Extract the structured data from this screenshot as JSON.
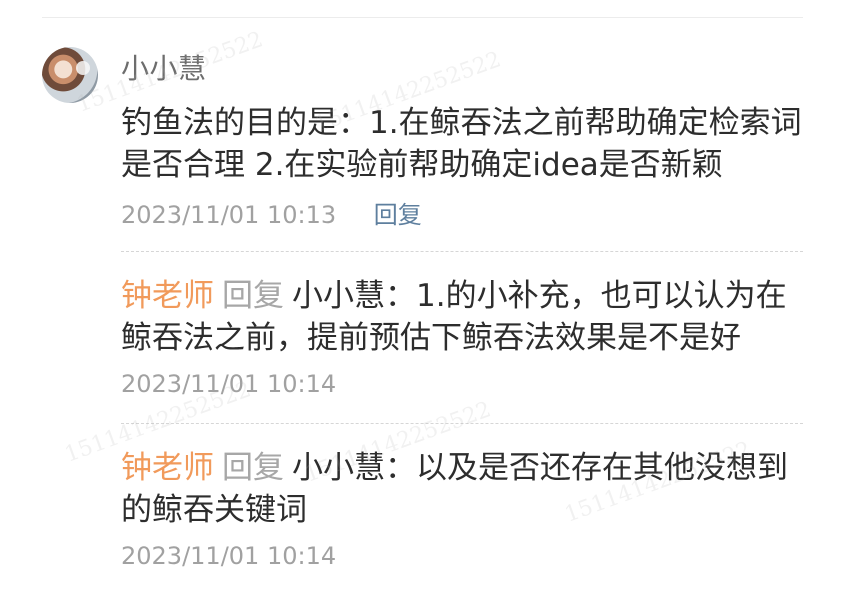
{
  "comment": {
    "author": "小小慧",
    "content": "钓鱼法的目的是：1.在鲸吞法之前帮助确定检索词是否合理 2.在实验前帮助确定idea是否新颖",
    "time": "2023/11/01 10:13",
    "reply_label": "回复",
    "avatar": "avatar"
  },
  "replies": [
    {
      "teacher": "钟老师",
      "reply_word": "回复",
      "target": "小小慧：",
      "content": "1.的小补充，也可以认为在鲸吞法之前，提前预估下鲸吞法效果是不是好",
      "time": "2023/11/01 10:14"
    },
    {
      "teacher": "钟老师",
      "reply_word": "回复",
      "target": "小小慧：",
      "content": "以及是否还存在其他没想到的鲸吞关键词",
      "time": "2023/11/01 10:14"
    }
  ],
  "watermark": "15114142252522",
  "colors": {
    "teacher": "#f19a5b",
    "reply_link": "#5e7f9e",
    "meta": "#a1a1a1",
    "text": "#2d2d2d"
  }
}
